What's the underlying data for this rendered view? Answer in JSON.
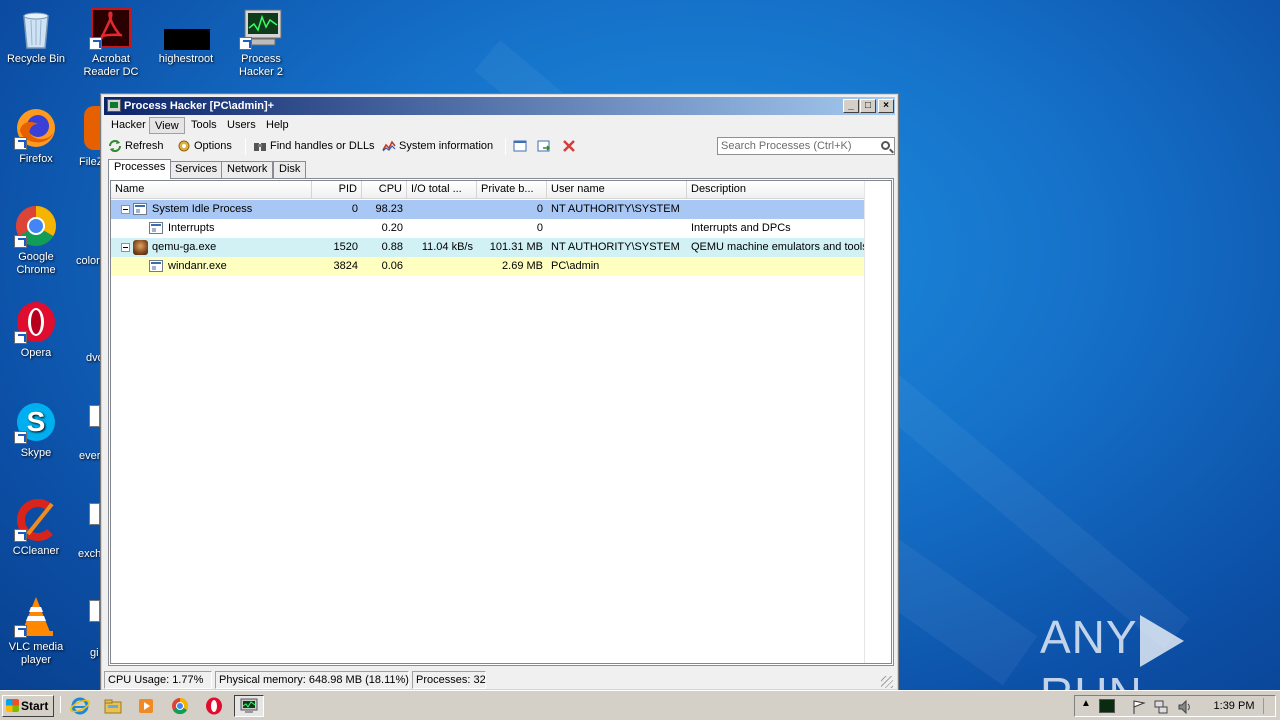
{
  "desktop": {
    "icons": [
      {
        "label_line1": "Recycle Bin",
        "label_line2": ""
      },
      {
        "label_line1": "Acrobat",
        "label_line2": "Reader DC"
      },
      {
        "label_line1": "highestroot",
        "label_line2": ""
      },
      {
        "label_line1": "Process",
        "label_line2": "Hacker 2"
      },
      {
        "label_line1": "Firefox",
        "label_line2": ""
      },
      {
        "label_line1": "Google",
        "label_line2": "Chrome"
      },
      {
        "label_line1": "Opera",
        "label_line2": ""
      },
      {
        "label_line1": "Skype",
        "label_line2": ""
      },
      {
        "label_line1": "CCleaner",
        "label_line2": ""
      },
      {
        "label_line1": "VLC media",
        "label_line2": "player"
      }
    ],
    "cut_labels": [
      "FileZ",
      "color",
      "dvd",
      "ever",
      "exch",
      "gi"
    ]
  },
  "window": {
    "title": "Process Hacker [PC\\admin]+",
    "menu": [
      "Hacker",
      "View",
      "Tools",
      "Users",
      "Help"
    ],
    "toolbar": {
      "refresh": "Refresh",
      "options": "Options",
      "find": "Find handles or DLLs",
      "sysinfo": "System information",
      "search_placeholder": "Search Processes (Ctrl+K)"
    },
    "tabs": [
      "Processes",
      "Services",
      "Network",
      "Disk"
    ],
    "columns": [
      "Name",
      "PID",
      "CPU",
      "I/O total ...",
      "Private b...",
      "User name",
      "Description"
    ],
    "rows": [
      {
        "name": "System Idle Process",
        "pid": "0",
        "cpu": "98.23",
        "io": "",
        "private": "0",
        "user": "NT AUTHORITY\\SYSTEM",
        "desc": ""
      },
      {
        "name": "Interrupts",
        "pid": "",
        "cpu": "0.20",
        "io": "",
        "private": "0",
        "user": "",
        "desc": "Interrupts and DPCs"
      },
      {
        "name": "qemu-ga.exe",
        "pid": "1520",
        "cpu": "0.88",
        "io": "11.04 kB/s",
        "private": "101.31 MB",
        "user": "NT AUTHORITY\\SYSTEM",
        "desc": "QEMU machine emulators and tools"
      },
      {
        "name": "windanr.exe",
        "pid": "3824",
        "cpu": "0.06",
        "io": "",
        "private": "2.69 MB",
        "user": "PC\\admin",
        "desc": ""
      }
    ],
    "row_colors": [
      "#a9c7f4",
      "#ffffff",
      "#d1f1f5",
      "#ffffc0"
    ],
    "status": {
      "cpu": "CPU Usage: 1.77%",
      "memory": "Physical memory: 648.98 MB (18.11%)",
      "processes": "Processes: 32"
    }
  },
  "taskbar": {
    "start": "Start",
    "clock": "1:39 PM"
  },
  "watermark": {
    "left": "ANY",
    "right": "RUN"
  }
}
